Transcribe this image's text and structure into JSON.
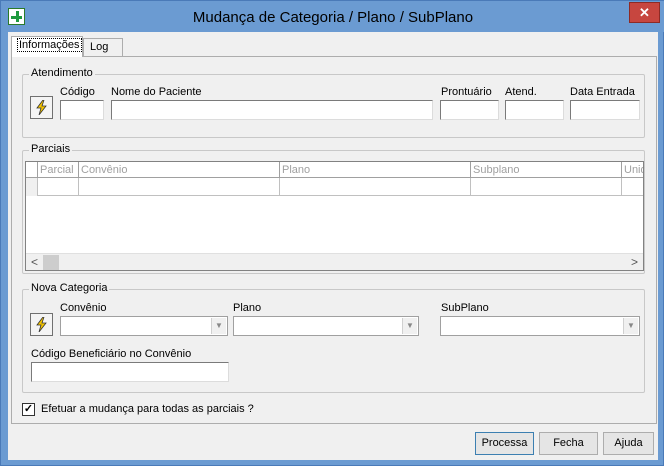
{
  "window": {
    "title": "Mudança de Categoria / Plano / SubPlano",
    "close_glyph": "✕",
    "app_icon": "plus-icon"
  },
  "tabs": [
    {
      "label": "Informações",
      "active": true
    },
    {
      "label": "Log",
      "active": false
    }
  ],
  "atendimento": {
    "group_label": "Atendimento",
    "codigo_label": "Código",
    "nome_label": "Nome do Paciente",
    "prontuario_label": "Prontuário",
    "atend_label": "Atend.",
    "data_entrada_label": "Data Entrada",
    "codigo_value": "",
    "nome_value": "",
    "prontuario_value": "",
    "atend_value": "",
    "data_entrada_value": ""
  },
  "parciais": {
    "group_label": "Parciais",
    "columns": [
      "Parcial",
      "Convênio",
      "Plano",
      "Subplano",
      "Unid"
    ],
    "rows": [
      [
        "",
        "",
        "",
        "",
        ""
      ]
    ],
    "scroll_left": "<",
    "scroll_right": ">"
  },
  "nova_categoria": {
    "group_label": "Nova Categoria",
    "convenio_label": "Convênio",
    "plano_label": "Plano",
    "subplano_label": "SubPlano",
    "beneficiario_label": "Código Beneficiário no Convênio",
    "convenio_value": "",
    "plano_value": "",
    "subplano_value": "",
    "beneficiario_value": "",
    "combo_arrow": "▼"
  },
  "todas_parciais": {
    "label": "Efetuar a mudança para todas as parciais ?",
    "checked": true,
    "check_glyph": "✓"
  },
  "buttons": {
    "processa": "Processa",
    "fecha": "Fecha",
    "ajuda": "Ajuda"
  }
}
